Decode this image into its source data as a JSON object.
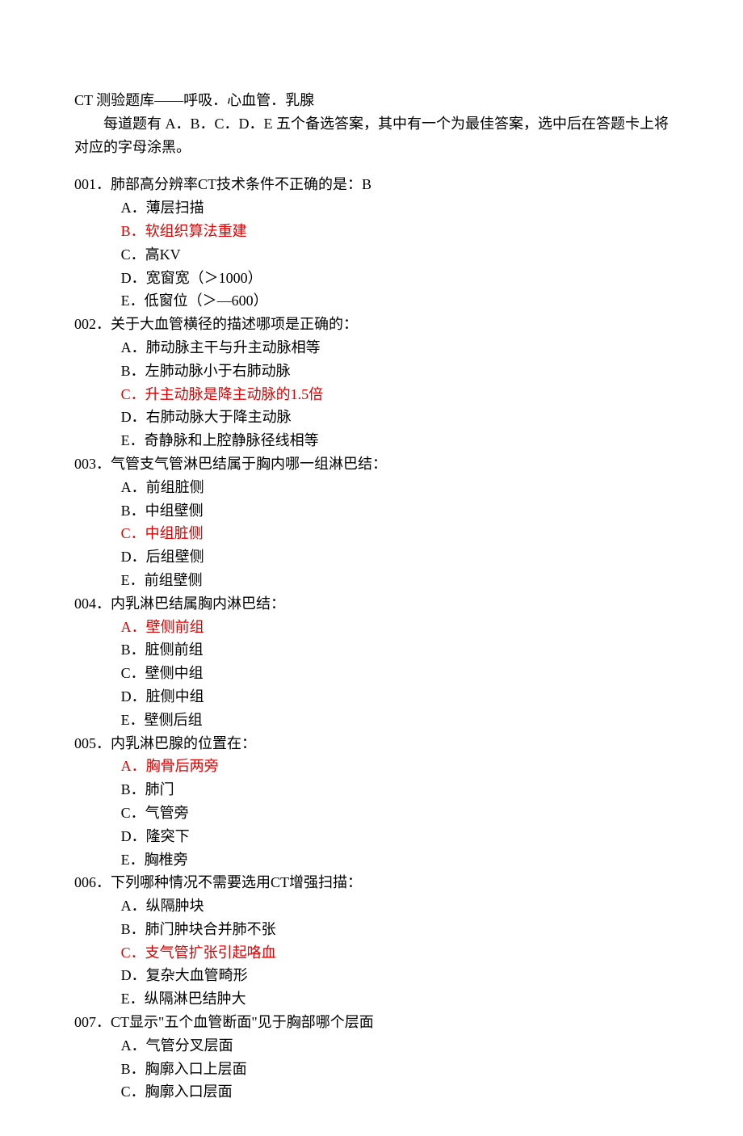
{
  "header": {
    "title": "CT 测验题库——呼吸．心血管．乳腺",
    "intro": "每道题有 A．B．C．D．E 五个备选答案，其中有一个为最佳答案，选中后在答题卡上将对应的字母涂黑。"
  },
  "questions": [
    {
      "num": "001．",
      "stem": "肺部高分辨率CT技术条件不正确的是：B",
      "options": [
        {
          "label": "A．薄层扫描",
          "red": false
        },
        {
          "label": "B．软组织算法重建",
          "red": true
        },
        {
          "label": "C．高KV",
          "red": false
        },
        {
          "label": "D．宽窗宽（＞1000）",
          "red": false
        },
        {
          "label": "E．低窗位（＞—600）",
          "red": false
        }
      ]
    },
    {
      "num": "002．",
      "stem": "关于大血管横径的描述哪项是正确的：",
      "options": [
        {
          "label": "A．肺动脉主干与升主动脉相等",
          "red": false
        },
        {
          "label": "B．左肺动脉小于右肺动脉",
          "red": false
        },
        {
          "label": "C．升主动脉是降主动脉的1.5倍",
          "red": true
        },
        {
          "label": "D．右肺动脉大于降主动脉",
          "red": false
        },
        {
          "label": "E．奇静脉和上腔静脉径线相等",
          "red": false
        }
      ]
    },
    {
      "num": "003．",
      "stem": "气管支气管淋巴结属于胸内哪一组淋巴结：",
      "options": [
        {
          "label": "A．前组脏侧",
          "red": false
        },
        {
          "label": "B．中组壁侧",
          "red": false
        },
        {
          "label": "C．中组脏侧",
          "red": true
        },
        {
          "label": "D．后组壁侧",
          "red": false
        },
        {
          "label": "E．前组壁侧",
          "red": false
        }
      ]
    },
    {
      "num": "004．",
      "stem": "内乳淋巴结属胸内淋巴结：",
      "options": [
        {
          "label": "A．壁侧前组",
          "red": true
        },
        {
          "label": "B．脏侧前组",
          "red": false
        },
        {
          "label": "C．壁侧中组",
          "red": false
        },
        {
          "label": "D．脏侧中组",
          "red": false
        },
        {
          "label": "E．壁侧后组",
          "red": false
        }
      ]
    },
    {
      "num": "005．",
      "stem": "内乳淋巴腺的位置在：",
      "options": [
        {
          "label": "A．胸骨后两旁",
          "red": true
        },
        {
          "label": "B．肺门",
          "red": false
        },
        {
          "label": "C．气管旁",
          "red": false
        },
        {
          "label": "D．隆突下",
          "red": false
        },
        {
          "label": "E．胸椎旁",
          "red": false
        }
      ]
    },
    {
      "num": "006．",
      "stem": "下列哪种情况不需要选用CT增强扫描：",
      "options": [
        {
          "label": "A．纵隔肿块",
          "red": false
        },
        {
          "label": "B．肺门肿块合并肺不张",
          "red": false
        },
        {
          "label": "C．支气管扩张引起咯血",
          "red": true
        },
        {
          "label": "D．复杂大血管畸形",
          "red": false
        },
        {
          "label": "E．纵隔淋巴结肿大",
          "red": false
        }
      ]
    },
    {
      "num": "007．",
      "stem": "CT显示\"五个血管断面\"见于胸部哪个层面",
      "options": [
        {
          "label": "A．气管分叉层面",
          "red": false
        },
        {
          "label": "B．胸廓入口上层面",
          "red": false
        },
        {
          "label": "C．胸廓入口层面",
          "red": false
        }
      ]
    }
  ]
}
